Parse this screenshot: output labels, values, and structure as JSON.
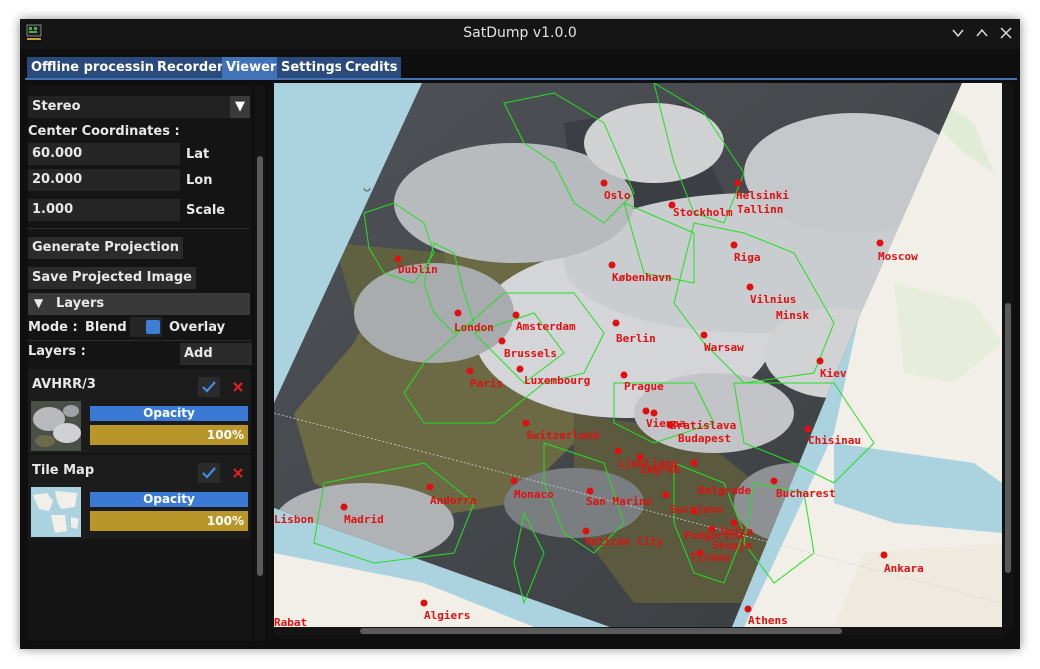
{
  "window": {
    "title": "SatDump v1.0.0"
  },
  "tabs": [
    {
      "label": "Offline processing"
    },
    {
      "label": "Recorder"
    },
    {
      "label": "Viewer"
    },
    {
      "label": "Settings"
    },
    {
      "label": "Credits"
    }
  ],
  "panel": {
    "projection": "Stereo",
    "center_label": "Center Coordinates :",
    "lat_value": "60.000",
    "lat_label": "Lat",
    "lon_value": "20.000",
    "lon_label": "Lon",
    "scale_value": "1.000",
    "scale_label": "Scale",
    "generate_button": "Generate Projection",
    "save_button": "Save Projected Image",
    "layers_header": "Layers",
    "mode_label": "Mode :",
    "blend_label": "Blend",
    "overlay_label": "Overlay",
    "layers_label": "Layers :",
    "add_layer_button": "Add Layer",
    "layers": [
      {
        "name": "AVHRR/3",
        "opacity_label": "Opacity",
        "opacity_value": "100%"
      },
      {
        "name": "Tile Map",
        "opacity_label": "Opacity",
        "opacity_value": "100%"
      }
    ]
  },
  "map": {
    "cities": [
      "Oslo",
      "Stockholm",
      "Helsinki",
      "Tallinn",
      "Dublin",
      "København",
      "Riga",
      "Moscow",
      "Vilnius",
      "Minsk",
      "London",
      "Amsterdam",
      "Berlin",
      "Warsaw",
      "Brussels",
      "Luxembourg",
      "Paris",
      "Prague",
      "Kiev",
      "Vienna",
      "Bratislava",
      "Budapest",
      "Chisinau",
      "Switzerland",
      "Ljubljana",
      "Zagreb",
      "Belgrade",
      "Bucharest",
      "Andorra",
      "Monaco",
      "San Marino",
      "Sarajevo",
      "Madrid",
      "Podgorica",
      "Sofia",
      "Skopje",
      "Vatican City",
      "Tirana",
      "Ankara",
      "Algiers",
      "Athens",
      "Lisbon",
      "Rabat"
    ]
  },
  "colors": {
    "accent": "#4272b8",
    "tab": "#294a7a",
    "gold": "#b8962a",
    "check": "#3d7ed6",
    "close": "#e02020"
  }
}
